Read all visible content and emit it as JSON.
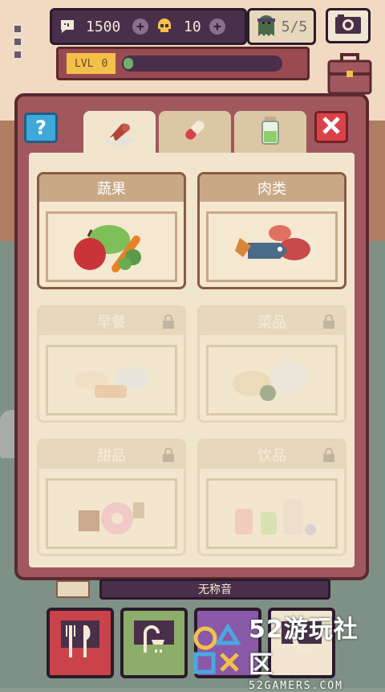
{
  "hud": {
    "coins": "1500",
    "skulls": "10",
    "guests": "5/5",
    "level_label": "LVL",
    "level_value": "0",
    "xp_progress_fraction": 0.05
  },
  "tabs": [
    {
      "name": "food",
      "icon": "drumstick-icon",
      "active": true
    },
    {
      "name": "medicine",
      "icon": "pill-icon",
      "active": false
    },
    {
      "name": "drink",
      "icon": "jar-icon",
      "active": false
    }
  ],
  "categories": [
    {
      "label": "蔬果",
      "locked": false,
      "icon": "vegetables-icon"
    },
    {
      "label": "肉类",
      "locked": false,
      "icon": "meat-icon"
    },
    {
      "label": "早餐",
      "locked": true,
      "icon": "breakfast-icon"
    },
    {
      "label": "菜品",
      "locked": true,
      "icon": "dishes-icon"
    },
    {
      "label": "甜品",
      "locked": true,
      "icon": "dessert-icon"
    },
    {
      "label": "饮品",
      "locked": true,
      "icon": "drinks-icon"
    }
  ],
  "bottom": {
    "name_strip": "无称音"
  },
  "watermark": {
    "title": "52游玩社区",
    "subtitle": "52GAMERS.COM"
  },
  "colors": {
    "panel": "#a0585e",
    "panel_inner": "#f1e5cd",
    "card_head": "#c9a886",
    "help": "#3fa8d8",
    "close": "#d8434a",
    "xp": "#6fb06a"
  }
}
